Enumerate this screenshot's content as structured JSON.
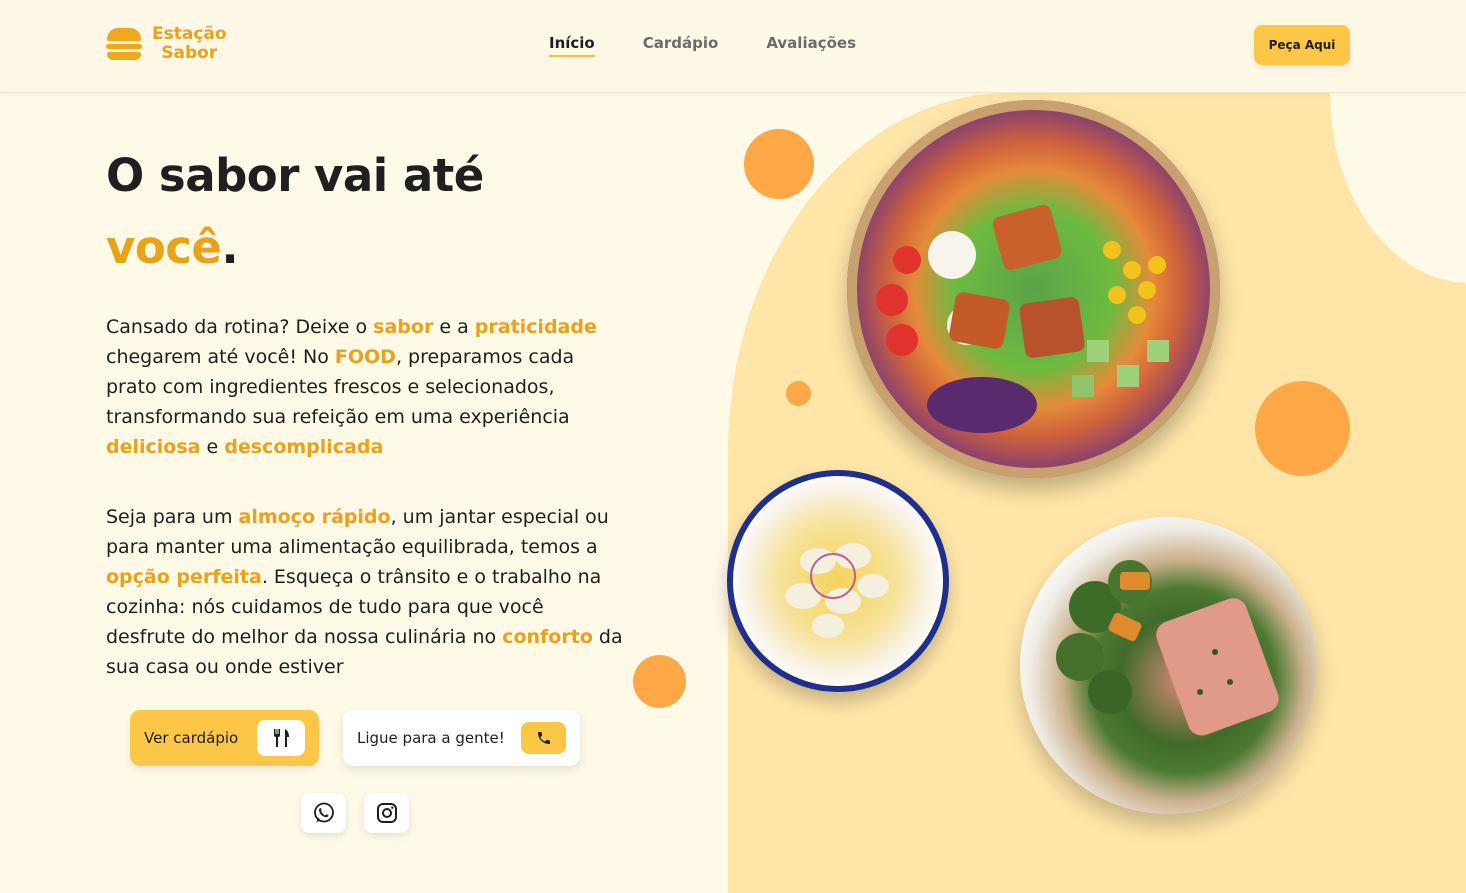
{
  "brand": {
    "name_line1": "Estação",
    "name_line2": "Sabor"
  },
  "nav": {
    "items": [
      {
        "label": "Início",
        "active": true
      },
      {
        "label": "Cardápio",
        "active": false
      },
      {
        "label": "Avaliações",
        "active": false
      }
    ],
    "cta_label": "Peça Aqui"
  },
  "hero": {
    "title_line1": "O sabor vai até",
    "title_accent": "você",
    "title_period": ".",
    "para1": {
      "t1": "Cansado da rotina? Deixe o ",
      "h1": "sabor",
      "t2": " e a ",
      "h2": "praticidade",
      "t3": " chegarem até você! No ",
      "h3": "FOOD",
      "t4": ", preparamos cada prato com ingredientes frescos e selecionados, transformando sua refeição em uma experiência ",
      "h4": "deliciosa",
      "t5": " e ",
      "h5": "descomplicada"
    },
    "para2": {
      "t1": "Seja para um ",
      "h1": "almoço rápido",
      "t2": ", um jantar especial ou para manter uma alimentação equilibrada, temos a ",
      "h2": "opção perfeita",
      "t3": ". Esqueça o trânsito e o trabalho na cozinha: nós cuidamos de tudo para que você desfrute do melhor da nossa culinária no ",
      "h3": "conforto",
      "t4": " da sua casa ou onde estiver"
    }
  },
  "buttons": {
    "menu_label": "Ver cardápio",
    "call_label": "Ligue para a gente!"
  },
  "icons": {
    "logo": "burger-icon",
    "menu": "fork-knife-icon",
    "call": "phone-icon",
    "whatsapp": "whatsapp-icon",
    "instagram": "instagram-icon"
  },
  "colors": {
    "accent": "#e9a21a",
    "button_yellow": "#fcc746",
    "background": "#fff9e8",
    "blob": "#ffe6a8",
    "orange_circle": "#ffa847"
  }
}
